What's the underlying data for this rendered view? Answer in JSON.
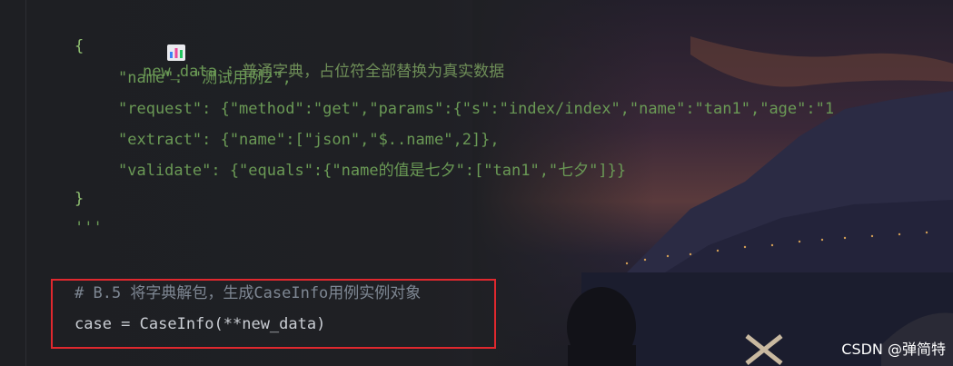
{
  "colors": {
    "string": "#6a9955",
    "comment": "#7e8793",
    "plain": "#c9cdd3",
    "highlight_border": "#e0282e",
    "watermark": "#ffffff"
  },
  "docstring": {
    "icon": "bar-chart-icon",
    "name": "new_data",
    "description": "：普通字典，占位符全部替换为真实数据"
  },
  "code": {
    "open_brace": "{",
    "line_name": "\"name\": \"测试用例2\",",
    "line_request": "\"request\": {\"method\":\"get\",\"params\":{\"s\":\"index/index\",\"name\":\"tan1\",\"age\":\"1",
    "line_extract": "\"extract\": {\"name\":[\"json\",\"$..name\",2]},",
    "line_validate": "\"validate\": {\"equals\":{\"name的值是七夕\":[\"tan1\",\"七夕\"]}}",
    "close_brace": "}",
    "triple_quote": "'''",
    "comment_line": "# B.5 将字典解包，生成CaseInfo用例实例对象",
    "statement_line": "case = CaseInfo(**new_data)"
  },
  "watermark": "CSDN @弹简特"
}
